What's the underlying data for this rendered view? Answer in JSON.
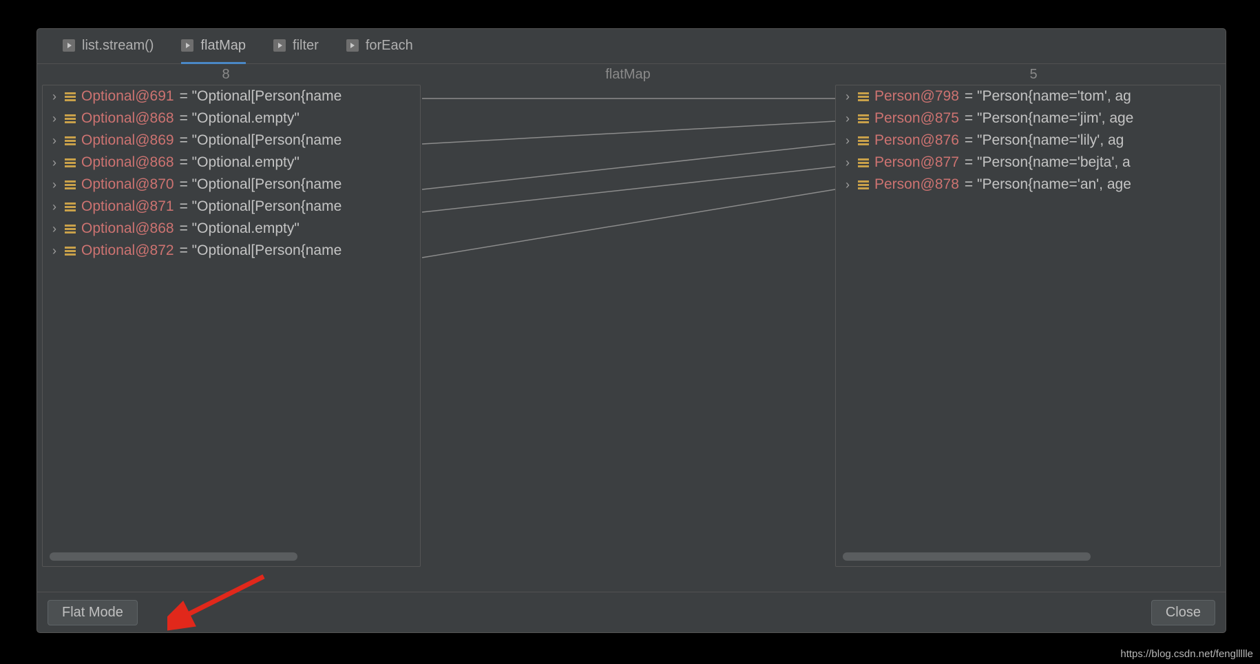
{
  "tabs": [
    {
      "label": "list.stream()"
    },
    {
      "label": "flatMap"
    },
    {
      "label": "filter"
    },
    {
      "label": "forEach"
    }
  ],
  "active_tab_index": 1,
  "columns": {
    "left_count": "8",
    "mid_title": "flatMap",
    "right_count": "5"
  },
  "left_items": [
    {
      "ref": "Optional@691",
      "val": " = \"Optional[Person{name"
    },
    {
      "ref": "Optional@868",
      "val": " = \"Optional.empty\""
    },
    {
      "ref": "Optional@869",
      "val": " = \"Optional[Person{name"
    },
    {
      "ref": "Optional@868",
      "val": " = \"Optional.empty\""
    },
    {
      "ref": "Optional@870",
      "val": " = \"Optional[Person{name"
    },
    {
      "ref": "Optional@871",
      "val": " = \"Optional[Person{name"
    },
    {
      "ref": "Optional@868",
      "val": " = \"Optional.empty\""
    },
    {
      "ref": "Optional@872",
      "val": " = \"Optional[Person{name"
    }
  ],
  "right_items": [
    {
      "ref": "Person@798",
      "val": " = \"Person{name='tom', ag"
    },
    {
      "ref": "Person@875",
      "val": " = \"Person{name='jim', age"
    },
    {
      "ref": "Person@876",
      "val": " = \"Person{name='lily', ag"
    },
    {
      "ref": "Person@877",
      "val": " = \"Person{name='bejta', a"
    },
    {
      "ref": "Person@878",
      "val": " = \"Person{name='an', age"
    }
  ],
  "connections": [
    {
      "from": 0,
      "to": 0
    },
    {
      "from": 2,
      "to": 1
    },
    {
      "from": 4,
      "to": 2
    },
    {
      "from": 5,
      "to": 3
    },
    {
      "from": 7,
      "to": 4
    }
  ],
  "buttons": {
    "flat_mode": "Flat Mode",
    "close": "Close"
  },
  "watermark": "https://blog.csdn.net/fengllllle"
}
